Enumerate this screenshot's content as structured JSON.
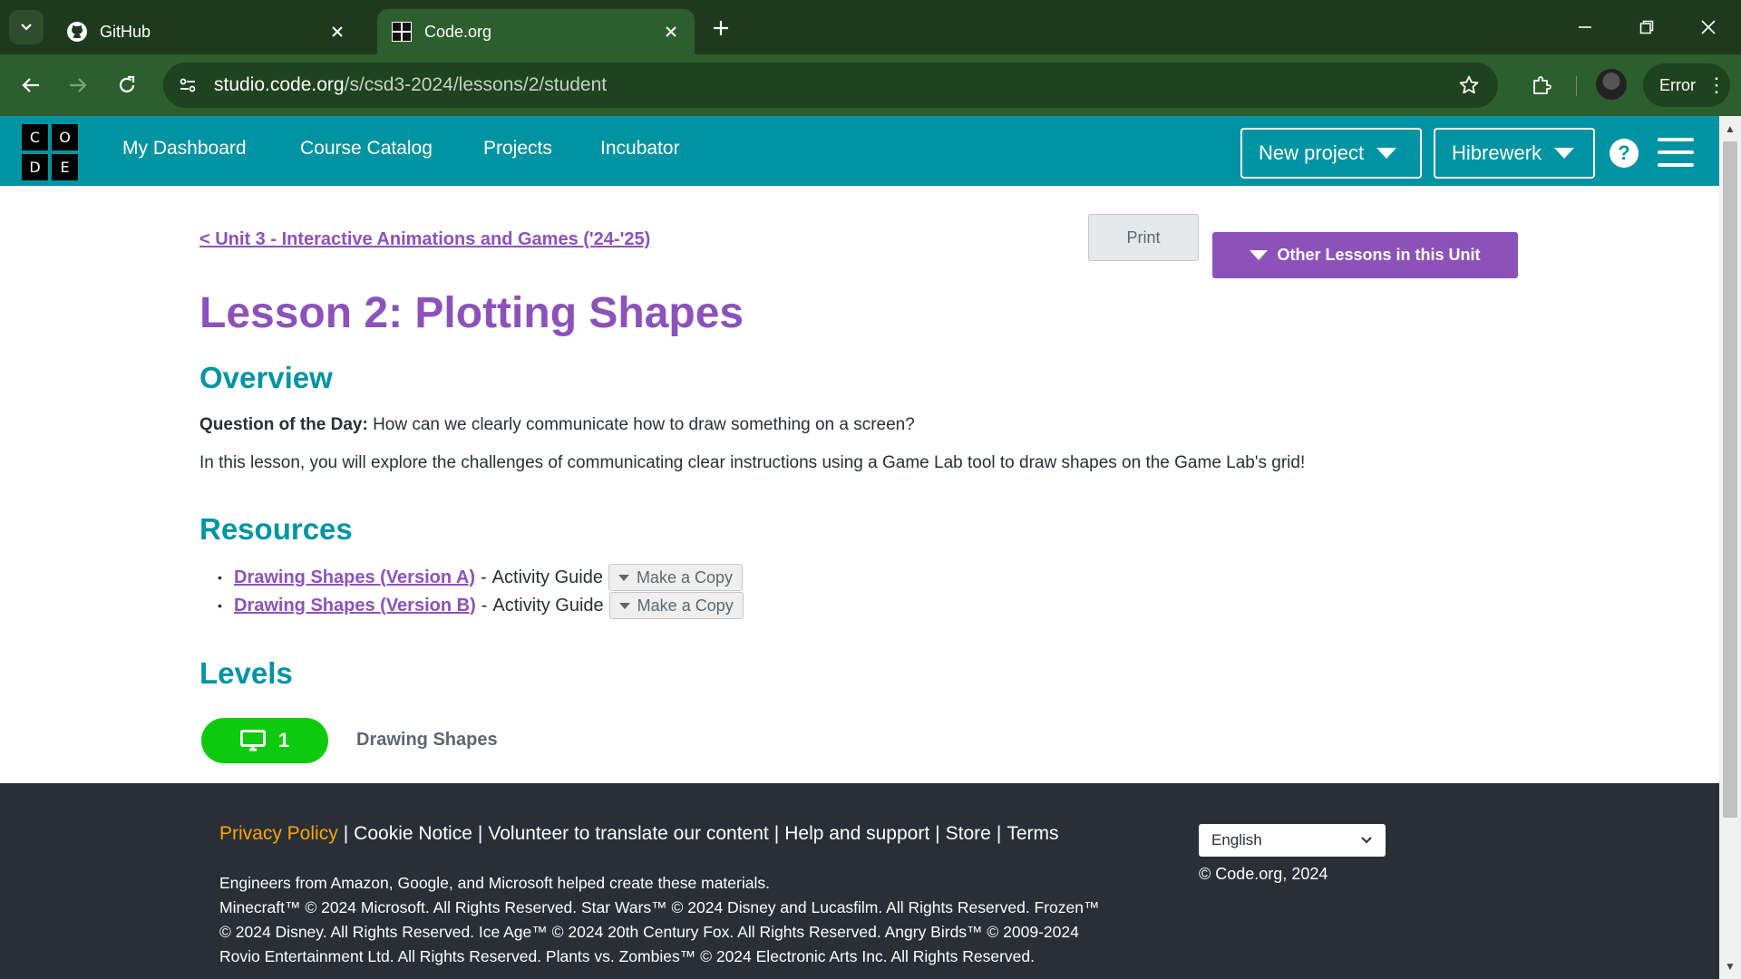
{
  "browser": {
    "tabs": [
      {
        "title": "GitHub",
        "icon": "github-icon",
        "active": false
      },
      {
        "title": "Code.org",
        "icon": "code-org-favicon",
        "active": true
      }
    ],
    "url_host": "studio.code.org",
    "url_path": "/s/csd3-2024/lessons/2/student",
    "profile_status": "Error"
  },
  "header": {
    "logo_letters": [
      "C",
      "O",
      "D",
      "E"
    ],
    "nav": [
      "My Dashboard",
      "Course Catalog",
      "Projects",
      "Incubator"
    ],
    "new_project_label": "New project",
    "user_label": "Hibrewerk",
    "help_label": "?",
    "brand_color": "#0094a3"
  },
  "lesson": {
    "back_link": "< Unit 3 - Interactive Animations and Games ('24-'25)",
    "print_label": "Print",
    "other_lessons_label": "Other Lessons in this Unit",
    "title": "Lesson 2: Plotting Shapes",
    "accent_color": "#8c52ba",
    "overview_heading": "Overview",
    "qotd_label": "Question of the Day:",
    "qotd_text": " How can we clearly communicate how to draw something on a screen?",
    "description": "In this lesson, you will explore the challenges of communicating clear instructions using a Game Lab tool to draw shapes on the Game Lab's grid!",
    "resources_heading": "Resources",
    "resources": [
      {
        "link": "Drawing Shapes (Version A)",
        "suffix": "Activity Guide",
        "button": "Make a Copy"
      },
      {
        "link": "Drawing Shapes (Version B)",
        "suffix": "Activity Guide",
        "button": "Make a Copy"
      }
    ],
    "levels_heading": "Levels",
    "level": {
      "number": "1",
      "name": "Drawing Shapes",
      "icon": "monitor-icon",
      "status_color": "#0eca0e"
    }
  },
  "footer": {
    "links": [
      "Privacy Policy",
      "Cookie Notice",
      "Volunteer to translate our content",
      "Help and support",
      "Store",
      "Terms"
    ],
    "language": "English",
    "copyright": "© Code.org, 2024",
    "legal_lines": [
      "Engineers from Amazon, Google, and Microsoft helped create these materials.",
      "Minecraft™ © 2024 Microsoft. All Rights Reserved. Star Wars™ © 2024 Disney and Lucasfilm. All Rights Reserved. Frozen™",
      "© 2024 Disney. All Rights Reserved. Ice Age™ © 2024 20th Century Fox. All Rights Reserved. Angry Birds™ © 2009-2024",
      "Rovio Entertainment Ltd. All Rights Reserved. Plants vs. Zombies™ © 2024 Electronic Arts Inc. All Rights Reserved."
    ]
  }
}
